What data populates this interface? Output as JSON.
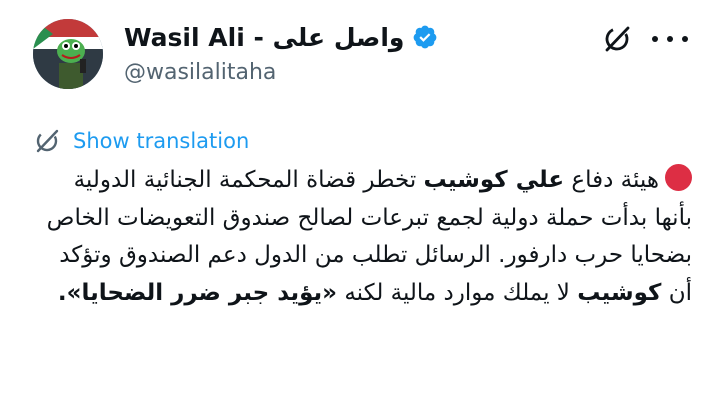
{
  "author": {
    "display_name": "Wasil Ali - واصل على",
    "handle": "@wasilalitaha",
    "verified": true,
    "accent_color": "#1d9bf0"
  },
  "actions": {
    "grok_icon": "grok-icon",
    "more_icon": "more-icon"
  },
  "translate": {
    "label": "Show translation",
    "icon": "globe-icon"
  },
  "tweet": {
    "bullet_icon": "red-circle",
    "bullet_color": "#dd2e44",
    "seg1": "هيئة دفاع ",
    "bold1": "علي كوشيب",
    "seg2": " تخطر قضاة المحكمة الجنائية الدولية بأنها بدأت حملة دولية لجمع تبرعات لصالح صندوق التعويضات الخاص بضحايا حرب دارفور. الرسائل تطلب من الدول دعم الصندوق وتؤكد أن ",
    "bold2": "كوشيب",
    "seg3": " لا يملك موارد مالية لكنه ",
    "bold3": "«يؤيد جبر ضرر الضحايا»."
  }
}
